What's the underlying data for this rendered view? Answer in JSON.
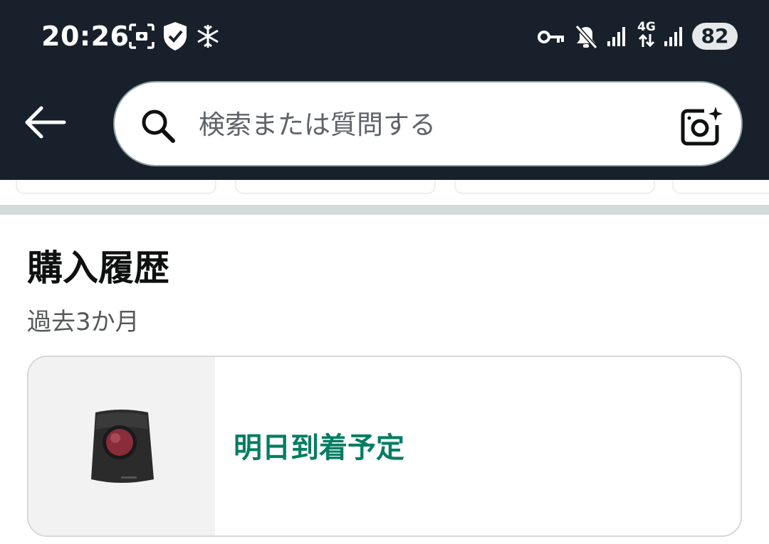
{
  "status_bar": {
    "time": "20:26",
    "network": "4G",
    "battery": "82",
    "icons": [
      "screenshot-icon",
      "shield-check-icon",
      "snowflake-icon",
      "key-icon",
      "mute-icon",
      "signal-icon",
      "data-arrows-icon",
      "signal-icon"
    ]
  },
  "header": {
    "search_placeholder": "検索または質問する",
    "icons": [
      "back-arrow-icon",
      "search-icon",
      "camera-sparkle-icon"
    ]
  },
  "section": {
    "title": "購入履歴",
    "subtitle": "過去3か月"
  },
  "order_card": {
    "delivery_status": "明日到着予定",
    "status_color": "#067d62",
    "product_image": "trackball-mouse"
  }
}
